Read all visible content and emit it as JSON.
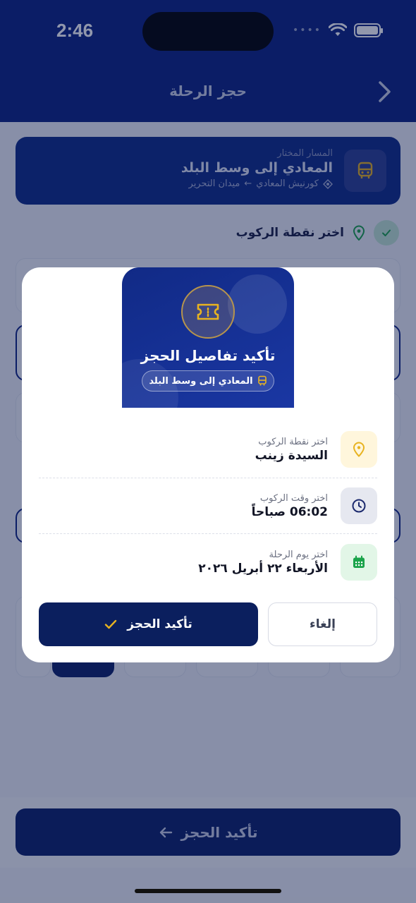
{
  "status_bar": {
    "time": "2:46"
  },
  "header": {
    "title": "حجز الرحلة"
  },
  "route_card": {
    "kicker": "المسار المختار",
    "name": "المعادي إلى وسط البلد",
    "from": "كورنيش المعادي",
    "arrow": "←",
    "to": "ميدان التحرير"
  },
  "step": {
    "title": "اختر نقطة الركوب"
  },
  "modal": {
    "title": "تأكيد تفاصيل الحجز",
    "route_pill": "المعادي إلى وسط البلد",
    "details": [
      {
        "label": "اختر نقطة الركوب",
        "value": "السيدة زينب",
        "icon": "map-pin-icon",
        "icon_color": "#e8b320",
        "icon_bg": "#fff6dc"
      },
      {
        "label": "اختر وقت الركوب",
        "value": "06:02 صباحاً",
        "icon": "clock-icon",
        "icon_color": "#1c2a6e",
        "icon_bg": "#e6e8f0"
      },
      {
        "label": "اختر يوم الرحلة",
        "value": "الأربعاء ٢٢ أبريل ٢٠٢٦",
        "icon": "calendar-icon",
        "icon_color": "#1aa34a",
        "icon_bg": "#e2f6e7"
      }
    ],
    "confirm_label": "تأكيد الحجز",
    "cancel_label": "إلغاء"
  },
  "bottom_button": {
    "label": "تأكيد الحجز"
  },
  "colors": {
    "primary": "#0b2180",
    "accent": "#e8b320",
    "success": "#1aa34a"
  }
}
